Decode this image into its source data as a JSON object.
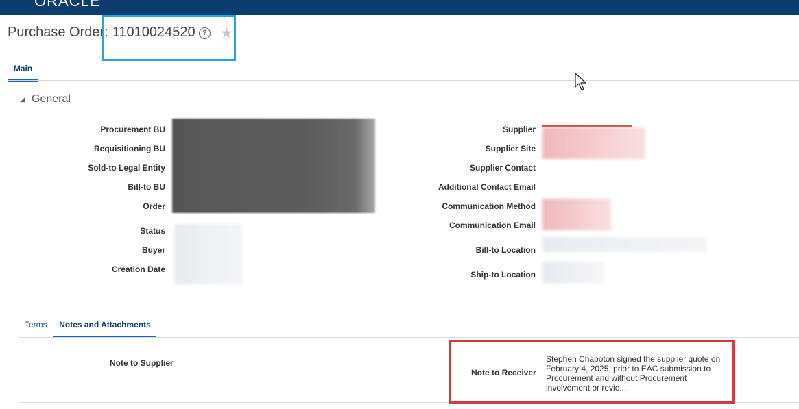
{
  "app": {
    "logo_text": "ORACLE"
  },
  "header": {
    "title_prefix": "Purchase Order:",
    "po_number": "11010024520",
    "help_icon": "help-circle-icon",
    "favorite_icon": "star-icon"
  },
  "tabs": {
    "main": "Main"
  },
  "general": {
    "section_title": "General",
    "left_labels": {
      "procurement_bu": "Procurement BU",
      "requisitioning_bu": "Requisitioning BU",
      "sold_to": "Sold-to Legal Entity",
      "bill_to_bu": "Bill-to BU",
      "order": "Order",
      "status": "Status",
      "buyer": "Buyer",
      "creation_date": "Creation Date"
    },
    "right_labels": {
      "supplier": "Supplier",
      "supplier_site": "Supplier Site",
      "supplier_contact": "Supplier Contact",
      "additional_email": "Additional Contact Email",
      "comm_method": "Communication Method",
      "comm_email": "Communication Email",
      "bill_to_location": "Bill-to Location",
      "ship_to_location": "Ship-to Location"
    }
  },
  "subtabs": {
    "terms": "Terms",
    "notes": "Notes and Attachments"
  },
  "notes": {
    "note_to_supplier_label": "Note to Supplier",
    "note_to_receiver_label": "Note to Receiver",
    "note_to_receiver_text": "Stephen Chapoton signed the supplier quote on February 4, 2025, prior to EAC submission to Procurement and without Procurement involvement or revie..."
  },
  "colors": {
    "topbar": "#0b3d6e",
    "highlight_blue": "#29a3e8",
    "highlight_red": "#d33a3f"
  }
}
